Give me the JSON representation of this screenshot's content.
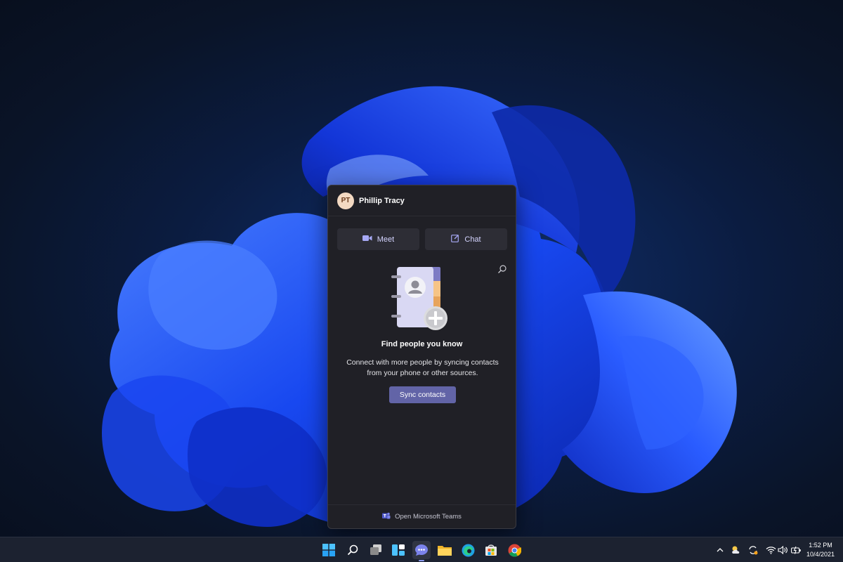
{
  "chat_flyout": {
    "user": {
      "initials": "PT",
      "name": "Phillip Tracy"
    },
    "meet_label": "Meet",
    "chat_label": "Chat",
    "find_title": "Find people you know",
    "find_description": "Connect with more people by syncing contacts from your phone or other sources.",
    "sync_button": "Sync contacts",
    "footer_link": "Open Microsoft Teams"
  },
  "taskbar": {
    "pinned_icons": [
      "windows-start-icon",
      "search-icon",
      "task-view-icon",
      "widgets-icon",
      "chat-icon",
      "file-explorer-icon",
      "edge-icon",
      "store-icon",
      "chrome-icon"
    ],
    "active_app": "chat-icon",
    "tray_icons": [
      "chevron-up-icon",
      "weather-icon",
      "sync-icon",
      "wifi-icon",
      "volume-icon",
      "battery-icon"
    ],
    "clock": {
      "time": "1:52 PM",
      "date": "10/4/2021"
    }
  },
  "colors": {
    "accent": "#6264a7",
    "flyout_bg": "#202026",
    "taskbar_bg": "#1c2230",
    "wallpaper_blue": "#1d4cff"
  }
}
